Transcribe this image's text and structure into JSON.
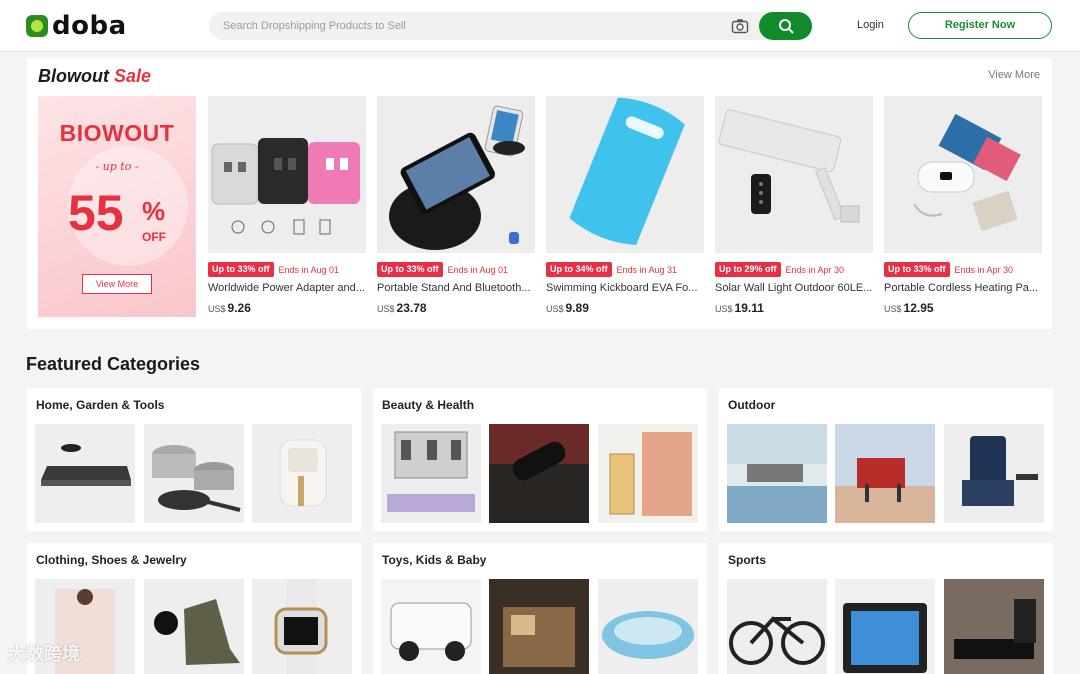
{
  "header": {
    "logo_text": "doba",
    "search_placeholder": "Search Dropshipping Products to Sell",
    "login_label": "Login",
    "register_label": "Register Now",
    "accent_color": "#118a2c"
  },
  "blowout": {
    "title_main": "Blowout",
    "title_accent": "Sale",
    "view_more": "View More",
    "promo": {
      "title": "BIOWOUT",
      "upto": "- up to -",
      "percent": "55",
      "percent_sign": "%",
      "off": "OFF",
      "button": "View More"
    },
    "products": [
      {
        "badge": "Up to 33% off",
        "ends": "Ends in Aug 01",
        "name": "Worldwide Power Adapter and...",
        "currency": "US$",
        "price": "9.26"
      },
      {
        "badge": "Up to 33% off",
        "ends": "Ends in Aug 01",
        "name": "Portable Stand And Bluetooth...",
        "currency": "US$",
        "price": "23.78"
      },
      {
        "badge": "Up to 34% off",
        "ends": "Ends in Aug 31",
        "name": "Swimming Kickboard EVA Fo...",
        "currency": "US$",
        "price": "9.89"
      },
      {
        "badge": "Up to 29% off",
        "ends": "Ends in Apr 30",
        "name": "Solar Wall Light Outdoor 60LE...",
        "currency": "US$",
        "price": "19.11"
      },
      {
        "badge": "Up to 33% off",
        "ends": "Ends in Apr 30",
        "name": "Portable Cordless Heating Pa...",
        "currency": "US$",
        "price": "12.95"
      }
    ]
  },
  "featured": {
    "title": "Featured Categories",
    "categories": [
      {
        "name": "Home, Garden & Tools"
      },
      {
        "name": "Beauty & Health"
      },
      {
        "name": "Outdoor"
      },
      {
        "name": "Clothing, Shoes & Jewelry"
      },
      {
        "name": "Toys, Kids & Baby"
      },
      {
        "name": "Sports"
      }
    ]
  },
  "watermark": "大数跨境"
}
